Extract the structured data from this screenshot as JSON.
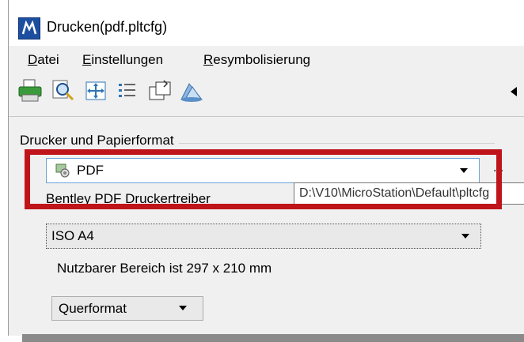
{
  "window": {
    "title": "Drucken(pdf.pltcfg)"
  },
  "menu": {
    "items": [
      {
        "accel": "D",
        "rest": "atei"
      },
      {
        "accel": "E",
        "rest": "instellungen"
      },
      {
        "accel": "R",
        "rest": "esymbolisierung"
      }
    ]
  },
  "toolbar": {
    "icons": [
      "printer-icon",
      "print-preview-icon",
      "fit-extent-icon",
      "list-icon",
      "page-setup-icon",
      "pen-table-icon"
    ]
  },
  "group": {
    "label": "Drucker und Papierformat"
  },
  "printer": {
    "value": "PDF",
    "ellipsis": "..."
  },
  "driver": {
    "label": "Bentley PDF Druckertreiber"
  },
  "tooltip": {
    "text": "D:\\V10\\MicroStation\\Default\\pltcfg"
  },
  "paper": {
    "value": "ISO A4"
  },
  "usable_area": {
    "text": "Nutzbarer Bereich ist 297 x 210 mm"
  },
  "orientation": {
    "value": "Querformat"
  },
  "colors": {
    "highlight": "#c0141b",
    "title_icon": "#1d4fa1"
  }
}
